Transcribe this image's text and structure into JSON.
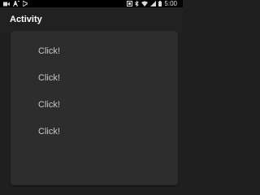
{
  "status_bar": {
    "time": "5:00",
    "icons_left": [
      "video-icon",
      "font-a-icon",
      "play-store-icon"
    ],
    "icons_right": [
      "screenshot-icon",
      "bluetooth-icon",
      "wifi-icon",
      "signal-icon",
      "battery-icon"
    ]
  },
  "app_bar": {
    "title": "Activity"
  },
  "list": {
    "items": [
      {
        "label": "Click!"
      },
      {
        "label": "Click!"
      },
      {
        "label": "Click!"
      },
      {
        "label": "Click!"
      }
    ]
  },
  "colors": {
    "background": "#1f1f1f",
    "card": "#2e2d2e",
    "text": "#c8c8c8",
    "title": "#ffffff"
  }
}
